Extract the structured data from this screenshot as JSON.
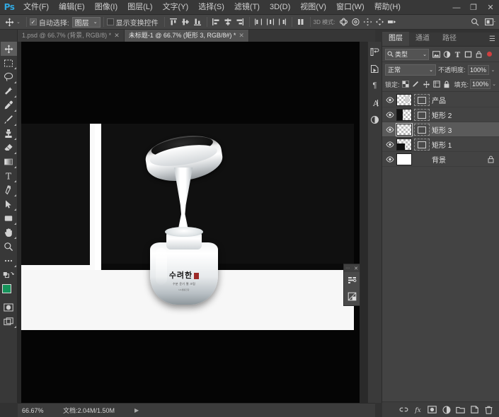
{
  "app": {
    "name": "Photoshop",
    "logo_text": "Ps"
  },
  "window_controls": [
    {
      "name": "minimize",
      "glyph": "—"
    },
    {
      "name": "maximize",
      "glyph": "❐"
    },
    {
      "name": "close",
      "glyph": "✕"
    }
  ],
  "menubar": {
    "items": [
      "文件(F)",
      "编辑(E)",
      "图像(I)",
      "图层(L)",
      "文字(Y)",
      "选择(S)",
      "滤镜(T)",
      "3D(D)",
      "视图(V)",
      "窗口(W)",
      "帮助(H)"
    ]
  },
  "options_bar": {
    "tool_icon": "move-tool",
    "auto_select_label": "自动选择:",
    "auto_select_checked": true,
    "auto_select_value": "图层",
    "show_transform_label": "显示变换控件",
    "show_transform_checked": false,
    "align_group_1": [
      "align-top-edges",
      "align-vertical-centers",
      "align-bottom-edges"
    ],
    "align_group_2": [
      "align-left-edges",
      "align-horizontal-centers",
      "align-right-edges"
    ],
    "distribute_group_1": [
      "distribute-top-edges",
      "distribute-vertical-centers",
      "distribute-bottom-edges"
    ],
    "distribute_group_2": [
      "distribute-left-edges",
      "distribute-horizontal-centers",
      "distribute-right-edges"
    ],
    "auto_align_icon": "auto-align-layers",
    "mode_3d_label": "3D 模式:",
    "mode_3d_icons": [
      "rotate-3d",
      "roll-3d",
      "drag-3d",
      "slide-3d",
      "scale-3d"
    ],
    "search_icon": "search-icon",
    "workspace_icon": "workspace-switcher"
  },
  "document_tabs": [
    {
      "label": "1.psd @ 66.7% (背景, RGB/8) *",
      "active": false,
      "close": "✕"
    },
    {
      "label": "未标题-1 @ 66.7% (矩形 3, RGB/8#) *",
      "active": true,
      "close": "✕"
    }
  ],
  "toolbar": {
    "tools": [
      {
        "name": "move-tool",
        "glyph": "✛",
        "active": true,
        "has_corner": false
      },
      {
        "name": "rectangular-marquee-tool",
        "glyph": "▭",
        "active": false,
        "has_corner": true
      },
      {
        "name": "lasso-tool",
        "glyph": "◯",
        "active": false,
        "has_corner": true
      },
      {
        "name": "quick-selection-tool",
        "glyph": "✎",
        "active": false,
        "has_corner": true
      },
      {
        "name": "eyedropper-tool",
        "glyph": "⚲",
        "active": false,
        "has_corner": true
      },
      {
        "name": "brush-tool",
        "glyph": "✒",
        "active": false,
        "has_corner": true
      },
      {
        "name": "clone-stamp-tool",
        "glyph": "⛨",
        "active": false,
        "has_corner": true
      },
      {
        "name": "eraser-tool",
        "glyph": "◣",
        "active": false,
        "has_corner": true
      },
      {
        "name": "gradient-tool",
        "glyph": "◨",
        "active": false,
        "has_corner": true
      },
      {
        "name": "horizontal-type-tool",
        "glyph": "T",
        "active": false,
        "has_corner": true
      },
      {
        "name": "pen-tool",
        "glyph": "✑",
        "active": false,
        "has_corner": true
      },
      {
        "name": "path-selection-tool",
        "glyph": "➤",
        "active": false,
        "has_corner": true
      },
      {
        "name": "rectangle-tool",
        "glyph": "▢",
        "active": false,
        "has_corner": true
      },
      {
        "name": "hand-tool",
        "glyph": "✋",
        "active": false,
        "has_corner": true
      },
      {
        "name": "zoom-tool",
        "glyph": "🔍",
        "active": false,
        "has_corner": false
      },
      {
        "name": "edit-toolbar-more",
        "glyph": "•••",
        "active": false,
        "has_corner": true
      }
    ],
    "swap_colors_icon": "swap-foreground-background",
    "default_colors_icon": "default-foreground-background",
    "foreground_color": "#15935a",
    "background_color": "#ffffff",
    "quick_mask_icon": "quick-mask-mode",
    "screen_mode_icon": "change-screen-mode"
  },
  "canvas": {
    "document_name": "未标题-1",
    "product": {
      "brand_text": "수려한",
      "sub_text": "수분 윤기 젤 크림",
      "sub_text2": "LG생활건강"
    },
    "mini_panel": {
      "grip": "⋯",
      "close": "✕",
      "buttons": [
        "properties-icon",
        "transform-icon"
      ]
    }
  },
  "status_bar": {
    "zoom": "66.67%",
    "doc_info": "文档:2.04M/1.50M",
    "arrow": "▶"
  },
  "icon_dock": [
    {
      "name": "history-panel-icon",
      "glyph": "↺"
    },
    {
      "name": "actions-panel-icon",
      "glyph": "▷"
    },
    {
      "name": "paragraph-panel-icon",
      "glyph": "¶"
    },
    {
      "name": "character-panel-icon",
      "glyph": "A"
    },
    {
      "name": "adjustments-panel-icon",
      "glyph": "◐"
    }
  ],
  "layers_panel": {
    "tabs": [
      {
        "label": "图层",
        "active": true
      },
      {
        "label": "通道",
        "active": false
      },
      {
        "label": "路径",
        "active": false
      }
    ],
    "menu_glyph": "☰",
    "filter": {
      "search_icon": "search-icon",
      "type_value": "类型",
      "caret": "⌄",
      "icons": [
        "filter-pixel-layers",
        "filter-adjustment-layers",
        "filter-type-layers",
        "filter-shape-layers",
        "filter-smart-objects"
      ],
      "toggle_dot_color": "#cf4040"
    },
    "blend": {
      "mode_value": "正常",
      "opacity_label": "不透明度:",
      "opacity_value": "100%",
      "caret": "⌄"
    },
    "lock": {
      "label": "锁定:",
      "icons": [
        "lock-transparent-pixels",
        "lock-image-pixels",
        "lock-position",
        "lock-artboard-nesting",
        "lock-all"
      ],
      "fill_label": "填充:",
      "fill_value": "100%"
    },
    "layers": [
      {
        "name": "产品",
        "visible": true,
        "selected": false,
        "thumb": "checker-product",
        "has_vector_mask": true,
        "locked": false
      },
      {
        "name": "矩形 2",
        "visible": true,
        "selected": false,
        "thumb": "black-left",
        "has_vector_mask": true,
        "locked": false
      },
      {
        "name": "矩形 3",
        "visible": true,
        "selected": true,
        "thumb": "checker-shape",
        "has_vector_mask": true,
        "locked": false
      },
      {
        "name": "矩形 1",
        "visible": true,
        "selected": false,
        "thumb": "black-corner",
        "has_vector_mask": true,
        "locked": false
      },
      {
        "name": "背景",
        "visible": true,
        "selected": false,
        "thumb": "white",
        "has_vector_mask": false,
        "locked": true,
        "lock_glyph": "🔒"
      }
    ],
    "footer_icons": [
      {
        "name": "link-layers-button",
        "glyph": "⛓"
      },
      {
        "name": "layer-style-button",
        "glyph": "fx"
      },
      {
        "name": "layer-mask-button",
        "glyph": "▣"
      },
      {
        "name": "new-adjustment-layer-button",
        "glyph": "◑"
      },
      {
        "name": "new-group-button",
        "glyph": "🗀"
      },
      {
        "name": "new-layer-button",
        "glyph": "🗋"
      },
      {
        "name": "delete-layer-button",
        "glyph": "🗑"
      }
    ]
  }
}
